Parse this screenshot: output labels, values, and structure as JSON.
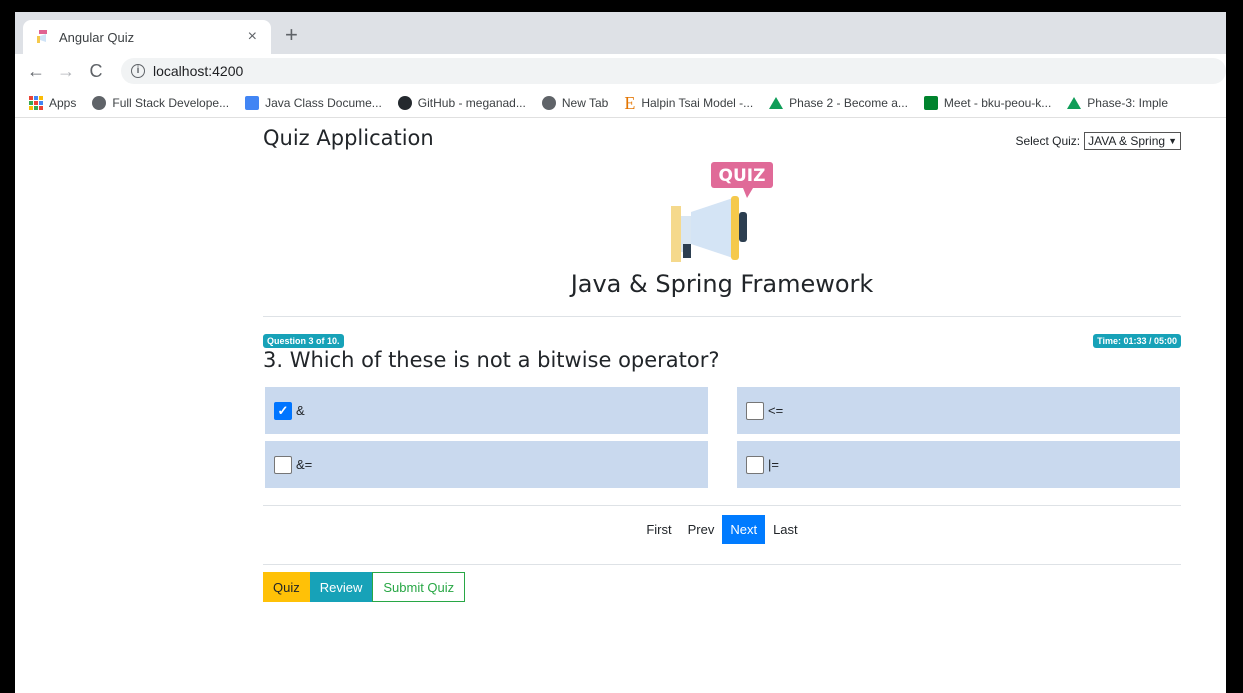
{
  "browser": {
    "tab_title": "Angular Quiz",
    "tab_close": "×",
    "new_tab": "+",
    "url": "localhost:4200",
    "bookmarks": [
      {
        "icon": "apps-icon",
        "label": "Apps"
      },
      {
        "icon": "globe-icon",
        "label": "Full Stack Develope..."
      },
      {
        "icon": "doc-icon",
        "label": "Java Class Docume..."
      },
      {
        "icon": "github-icon",
        "label": "GitHub - meganad..."
      },
      {
        "icon": "globe-icon",
        "label": "New Tab"
      },
      {
        "icon": "e-icon",
        "label": "Halpin Tsai Model -..."
      },
      {
        "icon": "drive-icon",
        "label": "Phase 2 - Become a..."
      },
      {
        "icon": "meet-icon",
        "label": "Meet - bku-peou-k..."
      },
      {
        "icon": "drive-icon",
        "label": "Phase-3: Imple"
      }
    ]
  },
  "header": {
    "title": "Quiz Application",
    "select_label": "Select Quiz:",
    "select_value": "JAVA & Spring"
  },
  "logo": {
    "text": "QUIZ"
  },
  "quiz": {
    "name": "Java & Spring Framework",
    "question_badge": "Question 3 of 10.",
    "time_badge": "Time: 01:33 / 05:00",
    "question": "3. Which of these is not a bitwise operator?",
    "options": [
      {
        "label": "&",
        "checked": true
      },
      {
        "label": "<=",
        "checked": false
      },
      {
        "label": "&=",
        "checked": false
      },
      {
        "label": "|=",
        "checked": false
      }
    ]
  },
  "pager": {
    "first": "First",
    "prev": "Prev",
    "next": "Next",
    "last": "Last"
  },
  "modes": {
    "quiz": "Quiz",
    "review": "Review",
    "submit": "Submit Quiz"
  },
  "colors": {
    "option_bg": "#c9d9ee",
    "accent": "#007bff",
    "teal": "#17a2b8",
    "yellow": "#ffc107",
    "green": "#28a745"
  }
}
